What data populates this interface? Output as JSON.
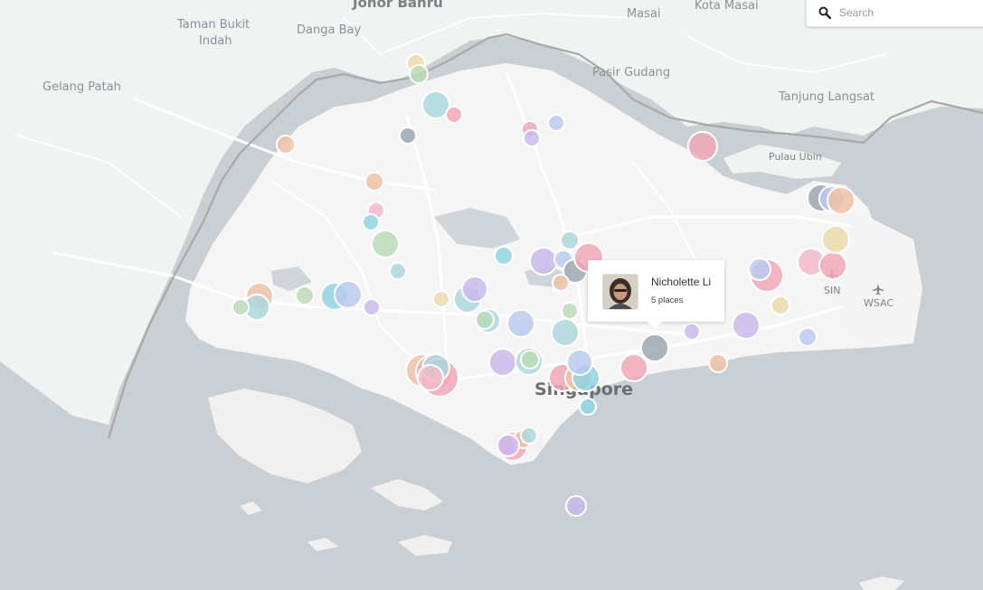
{
  "map": {
    "place_labels": {
      "johor_bahru": "Johor Bahru",
      "masai": "Masai",
      "kota_masai": "Kota Masai",
      "taman_bukit_indah_1": "Taman Bukit",
      "taman_bukit_indah_2": "Indah",
      "danga_bay": "Danga Bay",
      "gelang_patah": "Gelang Patah",
      "pasir_gudang": "Pasir Gudang",
      "tanjung_langsat": "Tanjung Langsat",
      "pulau_ubin": "Pulau Ubin",
      "singapore": "Singapore",
      "sin": "SIN",
      "wsac": "WSAC"
    },
    "colors": {
      "water": "#c9cfd2",
      "land": "#f4f4f4",
      "road": "#ffffff",
      "border": "#a9a9a9"
    },
    "marker_palette": [
      "#f2a6b4",
      "#a9d8de",
      "#b9c9f0",
      "#c9b8ec",
      "#f0c0a4",
      "#b9dcb4",
      "#ecdca8",
      "#9aa3ad",
      "#f3b9c8",
      "#8fd4e3"
    ]
  },
  "search": {
    "placeholder": "Search",
    "value": "",
    "icon": "search-icon"
  },
  "popup": {
    "name": "Nicholette Li",
    "places": "5 places",
    "avatar_icon": "avatar-photo"
  }
}
